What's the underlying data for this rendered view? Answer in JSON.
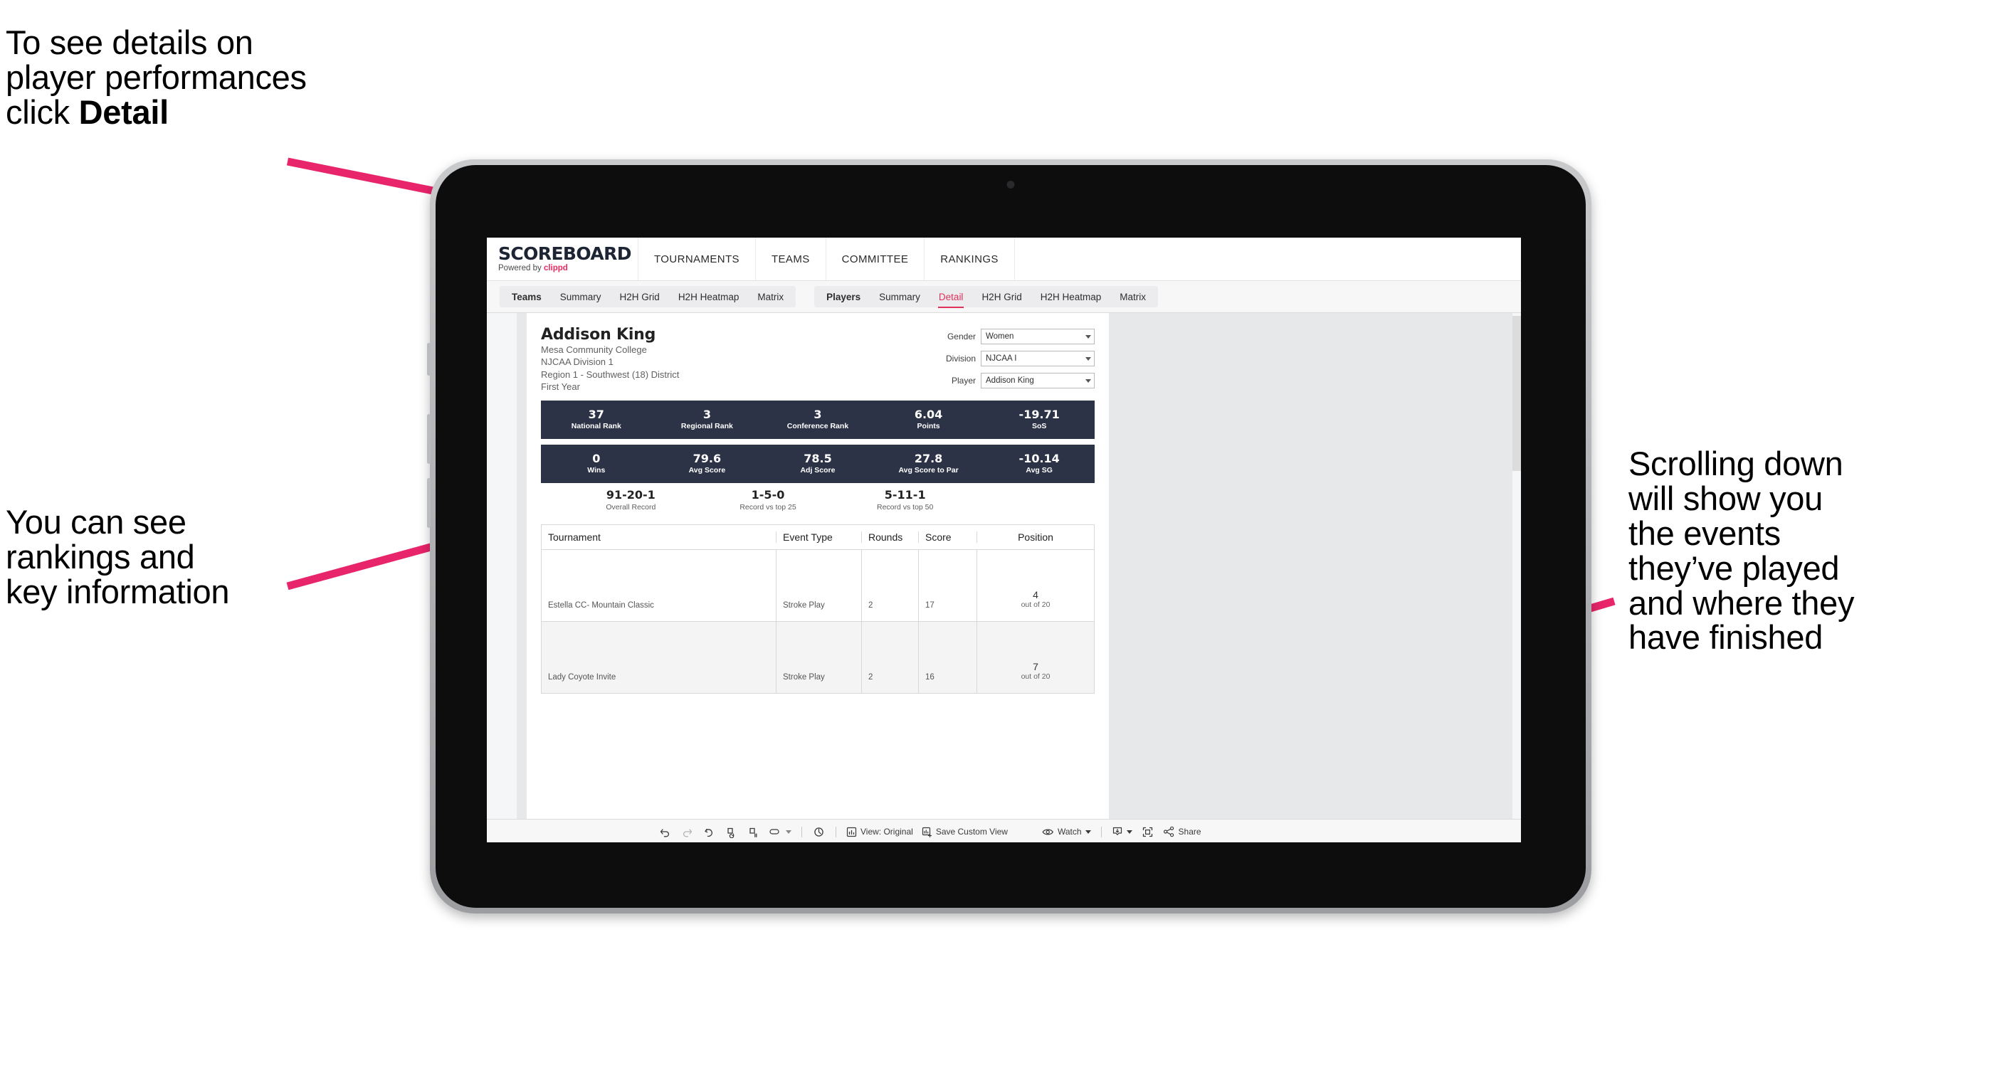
{
  "annotations": {
    "top_left": "To see details on\nplayer performances\nclick ",
    "top_left_bold": "Detail",
    "mid_left": "You can see\nrankings and\nkey information",
    "right": "Scrolling down\nwill show you\nthe events\nthey’ve played\nand where they\nhave finished"
  },
  "colors": {
    "accent_pink": "#ea2a5f",
    "arrow_pink": "#e8246a",
    "stat_navy": "#2d3347",
    "active_tab": "#e0315c"
  },
  "app": {
    "logo": {
      "word": "SCOREBOARD",
      "powered_prefix": "Powered by ",
      "powered_brand": "clippd"
    },
    "top_nav": [
      "TOURNAMENTS",
      "TEAMS",
      "COMMITTEE",
      "RANKINGS"
    ],
    "sub_nav": {
      "teams_group": [
        "Teams",
        "Summary",
        "H2H Grid",
        "H2H Heatmap",
        "Matrix"
      ],
      "players_group": [
        "Players",
        "Summary",
        "Detail",
        "H2H Grid",
        "H2H Heatmap",
        "Matrix"
      ],
      "active": "Detail"
    }
  },
  "player": {
    "name": "Addison King",
    "school": "Mesa Community College",
    "division": "NJCAA Division 1",
    "region": "Region 1 - Southwest (18) District",
    "class_year": "First Year"
  },
  "filters": [
    {
      "label": "Gender",
      "value": "Women"
    },
    {
      "label": "Division",
      "value": "NJCAA I"
    },
    {
      "label": "Player",
      "value": "Addison King"
    }
  ],
  "stats_row_1": [
    {
      "value": "37",
      "label": "National Rank"
    },
    {
      "value": "3",
      "label": "Regional Rank"
    },
    {
      "value": "3",
      "label": "Conference Rank"
    },
    {
      "value": "6.04",
      "label": "Points"
    },
    {
      "value": "-19.71",
      "label": "SoS"
    }
  ],
  "stats_row_2": [
    {
      "value": "0",
      "label": "Wins"
    },
    {
      "value": "79.6",
      "label": "Avg Score"
    },
    {
      "value": "78.5",
      "label": "Adj Score"
    },
    {
      "value": "27.8",
      "label": "Avg Score to Par"
    },
    {
      "value": "-10.14",
      "label": "Avg SG"
    }
  ],
  "records": [
    {
      "value": "91-20-1",
      "label": "Overall Record"
    },
    {
      "value": "1-5-0",
      "label": "Record vs top 25"
    },
    {
      "value": "5-11-1",
      "label": "Record vs top 50"
    }
  ],
  "table": {
    "columns": [
      "Tournament",
      "Event Type",
      "Rounds",
      "Score",
      "Position"
    ],
    "rows": [
      {
        "tournament": "Estella CC- Mountain Classic",
        "event_type": "Stroke Play",
        "rounds": "2",
        "score": "17",
        "position_value": "4",
        "position_sub": "out of 20"
      },
      {
        "tournament": "Lady Coyote Invite",
        "event_type": "Stroke Play",
        "rounds": "2",
        "score": "16",
        "position_value": "7",
        "position_sub": "out of 20"
      }
    ]
  },
  "toolbar": {
    "view_label": "View: Original",
    "save_label": "Save Custom View",
    "watch_label": "Watch",
    "share_label": "Share"
  }
}
